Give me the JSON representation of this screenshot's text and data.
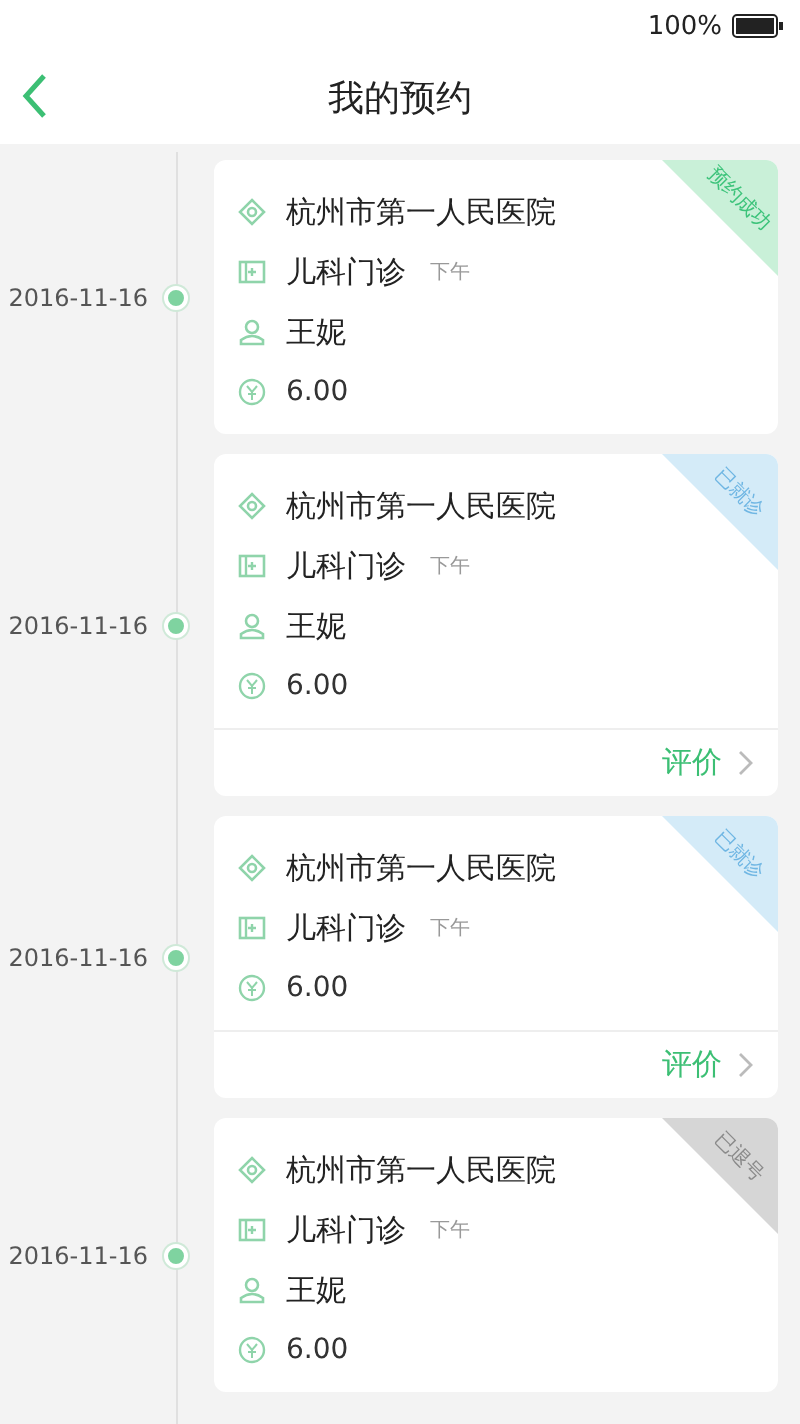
{
  "status_bar": {
    "battery_text": "100%"
  },
  "nav": {
    "title": "我的预约"
  },
  "appointments": [
    {
      "date": "2016-11-16",
      "hospital": "杭州市第一人民医院",
      "department": "儿科门诊",
      "period": "下午",
      "patient": "王妮",
      "price": "6.00",
      "status": {
        "label": "预约成功",
        "kind": "booked"
      }
    },
    {
      "date": "2016-11-16",
      "hospital": "杭州市第一人民医院",
      "department": "儿科门诊",
      "period": "下午",
      "patient": "王妮",
      "price": "6.00",
      "status": {
        "label": "已就诊",
        "kind": "visited"
      },
      "action": "评价"
    },
    {
      "date": "2016-11-16",
      "hospital": "杭州市第一人民医院",
      "department": "儿科门诊",
      "period": "下午",
      "price": "6.00",
      "status": {
        "label": "已就诊",
        "kind": "visited"
      },
      "action": "评价"
    },
    {
      "date": "2016-11-16",
      "hospital": "杭州市第一人民医院",
      "department": "儿科门诊",
      "period": "下午",
      "patient": "王妮",
      "price": "6.00",
      "status": {
        "label": "已退号",
        "kind": "cancelled"
      }
    }
  ]
}
